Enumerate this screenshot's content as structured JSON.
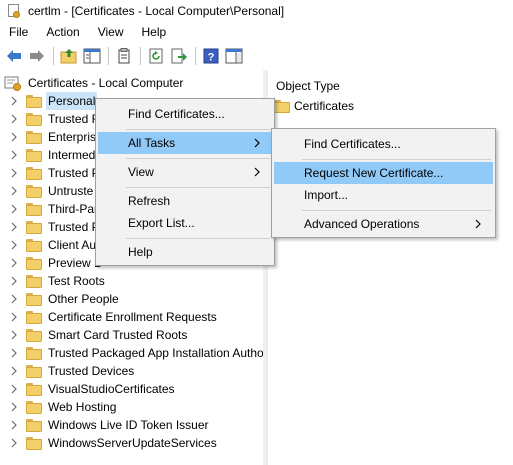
{
  "window": {
    "title": "certlm - [Certificates - Local Computer\\Personal]"
  },
  "menubar": {
    "items": [
      "File",
      "Action",
      "View",
      "Help"
    ]
  },
  "toolbar": {
    "buttons": [
      "back-arrow",
      "forward-arrow",
      "up-folder",
      "show-hide-tree",
      "properties",
      "refresh",
      "export-list",
      "help",
      "show-hide-action-pane"
    ]
  },
  "tree": {
    "root": "Certificates - Local Computer",
    "items": [
      {
        "label": "Personal",
        "selected": true
      },
      {
        "label": "Trusted R"
      },
      {
        "label": "Enterpris"
      },
      {
        "label": "Intermed"
      },
      {
        "label": "Trusted P"
      },
      {
        "label": "Untruste"
      },
      {
        "label": "Third-Par"
      },
      {
        "label": "Trusted P"
      },
      {
        "label": "Client Au"
      },
      {
        "label": "Preview B"
      },
      {
        "label": "Test Roots"
      },
      {
        "label": "Other People"
      },
      {
        "label": "Certificate Enrollment Requests"
      },
      {
        "label": "Smart Card Trusted Roots"
      },
      {
        "label": "Trusted Packaged App Installation Author"
      },
      {
        "label": "Trusted Devices"
      },
      {
        "label": "VisualStudioCertificates"
      },
      {
        "label": "Web Hosting"
      },
      {
        "label": "Windows Live ID Token Issuer"
      },
      {
        "label": "WindowsServerUpdateServices"
      }
    ]
  },
  "right_pane": {
    "column_header": "Object Type",
    "rows": [
      "Certificates"
    ]
  },
  "context_menu": {
    "items": {
      "find": "Find Certificates...",
      "all_tasks": "All Tasks",
      "view": "View",
      "refresh": "Refresh",
      "export": "Export List...",
      "help": "Help"
    },
    "highlighted": "All Tasks"
  },
  "submenu": {
    "items": {
      "find": "Find Certificates...",
      "request": "Request New Certificate...",
      "import": "Import...",
      "advanced": "Advanced Operations"
    },
    "highlighted": "Request New Certificate..."
  },
  "colors": {
    "menu_highlight": "#91c9f7",
    "tree_selection": "#cce4f7",
    "menu_background": "#f2f2f2",
    "folder": "#f3cf6a"
  }
}
